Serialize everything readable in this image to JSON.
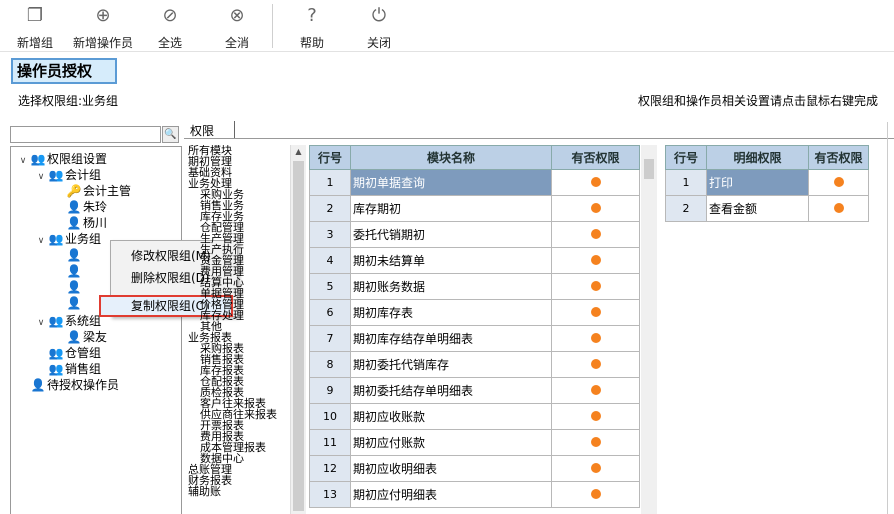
{
  "toolbar": {
    "buttons": [
      {
        "label": "新增组",
        "icon": "new-group-icon"
      },
      {
        "label": "新增操作员",
        "icon": "add-icon"
      },
      {
        "label": "全选",
        "icon": "check-all-icon"
      },
      {
        "label": "全消",
        "icon": "clear-all-icon"
      },
      {
        "label": "帮助",
        "icon": "help-icon"
      },
      {
        "label": "关闭",
        "icon": "power-icon"
      }
    ]
  },
  "page": {
    "title": "操作员授权",
    "selected_group": "选择权限组:业务组",
    "hint": "权限组和操作员相关设置请点击鼠标右键完成"
  },
  "search": {
    "value": "",
    "button": "🔍"
  },
  "tree": {
    "root": "权限组设置",
    "accounting": "会计组",
    "acc_members": [
      "会计主管",
      "朱玲",
      "杨川"
    ],
    "business": "业务组",
    "system": "系统组",
    "sys_members": [
      "梁友"
    ],
    "warehouse": "仓管组",
    "sales": "销售组",
    "pending": "待授权操作员"
  },
  "context_menu": {
    "items": [
      "修改权限组(M)",
      "删除权限组(D)",
      "复制权限组(C)"
    ],
    "highlighted": 2
  },
  "tab": {
    "label": "权限"
  },
  "modules": [
    "所有模块",
    "期初管理",
    "基础资料",
    "业务处理",
    " 采购业务",
    " 销售业务",
    " 库存业务",
    " 仓配管理",
    " 生产管理",
    " 生产执行",
    " 资金管理",
    " 费用管理",
    " 结算中心",
    " 单据管理",
    " 价格管理",
    " 库存处理",
    " 其他",
    "业务报表",
    " 采购报表",
    " 销售报表",
    " 库存报表",
    " 仓配报表",
    " 质检报表",
    " 客户往来报表",
    " 供应商往来报表",
    " 开票报表",
    " 费用报表",
    " 成本管理报表",
    " 数据中心",
    "总账管理",
    "财务报表",
    "辅助账"
  ],
  "main_grid": {
    "headers": [
      "行号",
      "模块名称",
      "有否权限"
    ],
    "rows": [
      {
        "no": "1",
        "name": "期初单据查询",
        "has": true
      },
      {
        "no": "2",
        "name": "库存期初",
        "has": true
      },
      {
        "no": "3",
        "name": "委托代销期初",
        "has": true
      },
      {
        "no": "4",
        "name": "期初未结算单",
        "has": true
      },
      {
        "no": "5",
        "name": "期初账务数据",
        "has": true
      },
      {
        "no": "6",
        "name": "期初库存表",
        "has": true
      },
      {
        "no": "7",
        "name": "期初库存结存单明细表",
        "has": true
      },
      {
        "no": "8",
        "name": "期初委托代销库存",
        "has": true
      },
      {
        "no": "9",
        "name": "期初委托结存单明细表",
        "has": true
      },
      {
        "no": "10",
        "name": "期初应收账款",
        "has": true
      },
      {
        "no": "11",
        "name": "期初应付账款",
        "has": true
      },
      {
        "no": "12",
        "name": "期初应收明细表",
        "has": true
      },
      {
        "no": "13",
        "name": "期初应付明细表",
        "has": true
      }
    ]
  },
  "detail_grid": {
    "headers": [
      "行号",
      "明细权限",
      "有否权限"
    ],
    "rows": [
      {
        "no": "1",
        "name": "打印",
        "has": true
      },
      {
        "no": "2",
        "name": "查看金额",
        "has": true
      }
    ]
  },
  "colors": {
    "accent": "#5b9bd5",
    "dot": "#f5821f",
    "selected_row": "#7e9bbd",
    "highlight": "#e03c31"
  }
}
